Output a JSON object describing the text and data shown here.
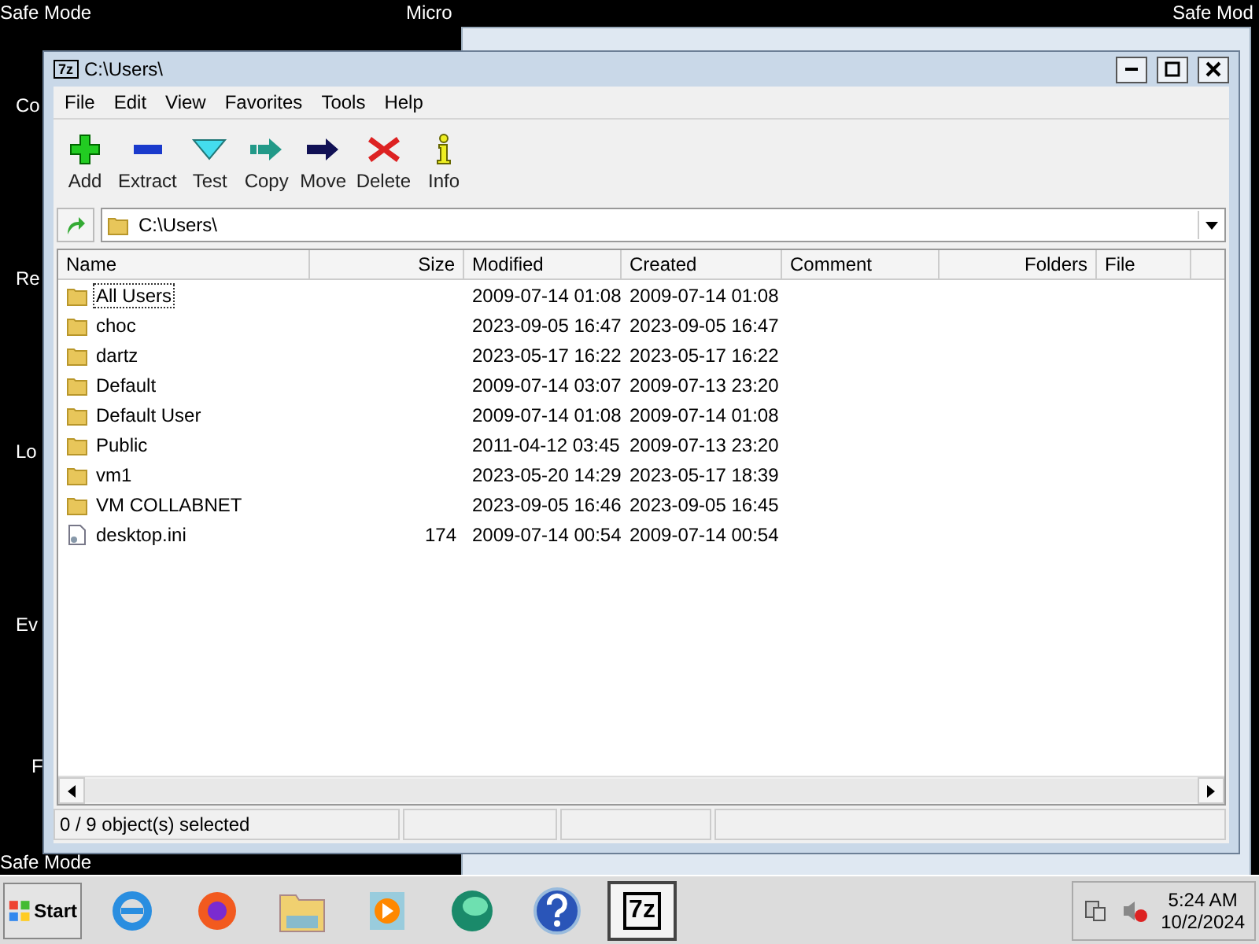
{
  "desktop": {
    "top_left": "Safe Mode",
    "top_center": "Micro",
    "top_right": "Safe Mod",
    "bottom_left": "Safe Mode",
    "icon_labels": [
      "Co",
      "Re",
      "Lo",
      "Ev",
      "F"
    ]
  },
  "window": {
    "logo": "7z",
    "title": "C:\\Users\\"
  },
  "menu": [
    "File",
    "Edit",
    "View",
    "Favorites",
    "Tools",
    "Help"
  ],
  "toolbar": [
    {
      "label": "Add",
      "kind": "add"
    },
    {
      "label": "Extract",
      "kind": "extract"
    },
    {
      "label": "Test",
      "kind": "test"
    },
    {
      "label": "Copy",
      "kind": "copy"
    },
    {
      "label": "Move",
      "kind": "move"
    },
    {
      "label": "Delete",
      "kind": "delete"
    },
    {
      "label": "Info",
      "kind": "info"
    }
  ],
  "address": {
    "value": "C:\\Users\\"
  },
  "table": {
    "columns": [
      "Name",
      "Size",
      "Modified",
      "Created",
      "Comment",
      "Folders",
      "File"
    ],
    "rows": [
      {
        "name": "All Users",
        "kind": "folder",
        "size": "",
        "modified": "2009-07-14 01:08",
        "created": "2009-07-14 01:08",
        "focused": true
      },
      {
        "name": "choc",
        "kind": "folder",
        "size": "",
        "modified": "2023-09-05 16:47",
        "created": "2023-09-05 16:47",
        "focused": false
      },
      {
        "name": "dartz",
        "kind": "folder",
        "size": "",
        "modified": "2023-05-17 16:22",
        "created": "2023-05-17 16:22",
        "focused": false
      },
      {
        "name": "Default",
        "kind": "folder",
        "size": "",
        "modified": "2009-07-14 03:07",
        "created": "2009-07-13 23:20",
        "focused": false
      },
      {
        "name": "Default User",
        "kind": "folder",
        "size": "",
        "modified": "2009-07-14 01:08",
        "created": "2009-07-14 01:08",
        "focused": false
      },
      {
        "name": "Public",
        "kind": "folder",
        "size": "",
        "modified": "2011-04-12 03:45",
        "created": "2009-07-13 23:20",
        "focused": false
      },
      {
        "name": "vm1",
        "kind": "folder",
        "size": "",
        "modified": "2023-05-20 14:29",
        "created": "2023-05-17 18:39",
        "focused": false
      },
      {
        "name": "VM COLLABNET",
        "kind": "folder",
        "size": "",
        "modified": "2023-09-05 16:46",
        "created": "2023-09-05 16:45",
        "focused": false
      },
      {
        "name": "desktop.ini",
        "kind": "file",
        "size": "174",
        "modified": "2009-07-14 00:54",
        "created": "2009-07-14 00:54",
        "focused": false
      }
    ]
  },
  "status_bar": "0 / 9 object(s) selected",
  "taskbar": {
    "start": "Start",
    "apps": [
      {
        "kind": "ie",
        "selected": false
      },
      {
        "kind": "firefox",
        "selected": false
      },
      {
        "kind": "explorer",
        "selected": false
      },
      {
        "kind": "media",
        "selected": false
      },
      {
        "kind": "globe",
        "selected": false
      },
      {
        "kind": "help",
        "selected": false
      },
      {
        "kind": "sevenzip",
        "label": "7z",
        "selected": true
      }
    ],
    "time": "5:24 AM",
    "date": "10/2/2024"
  }
}
